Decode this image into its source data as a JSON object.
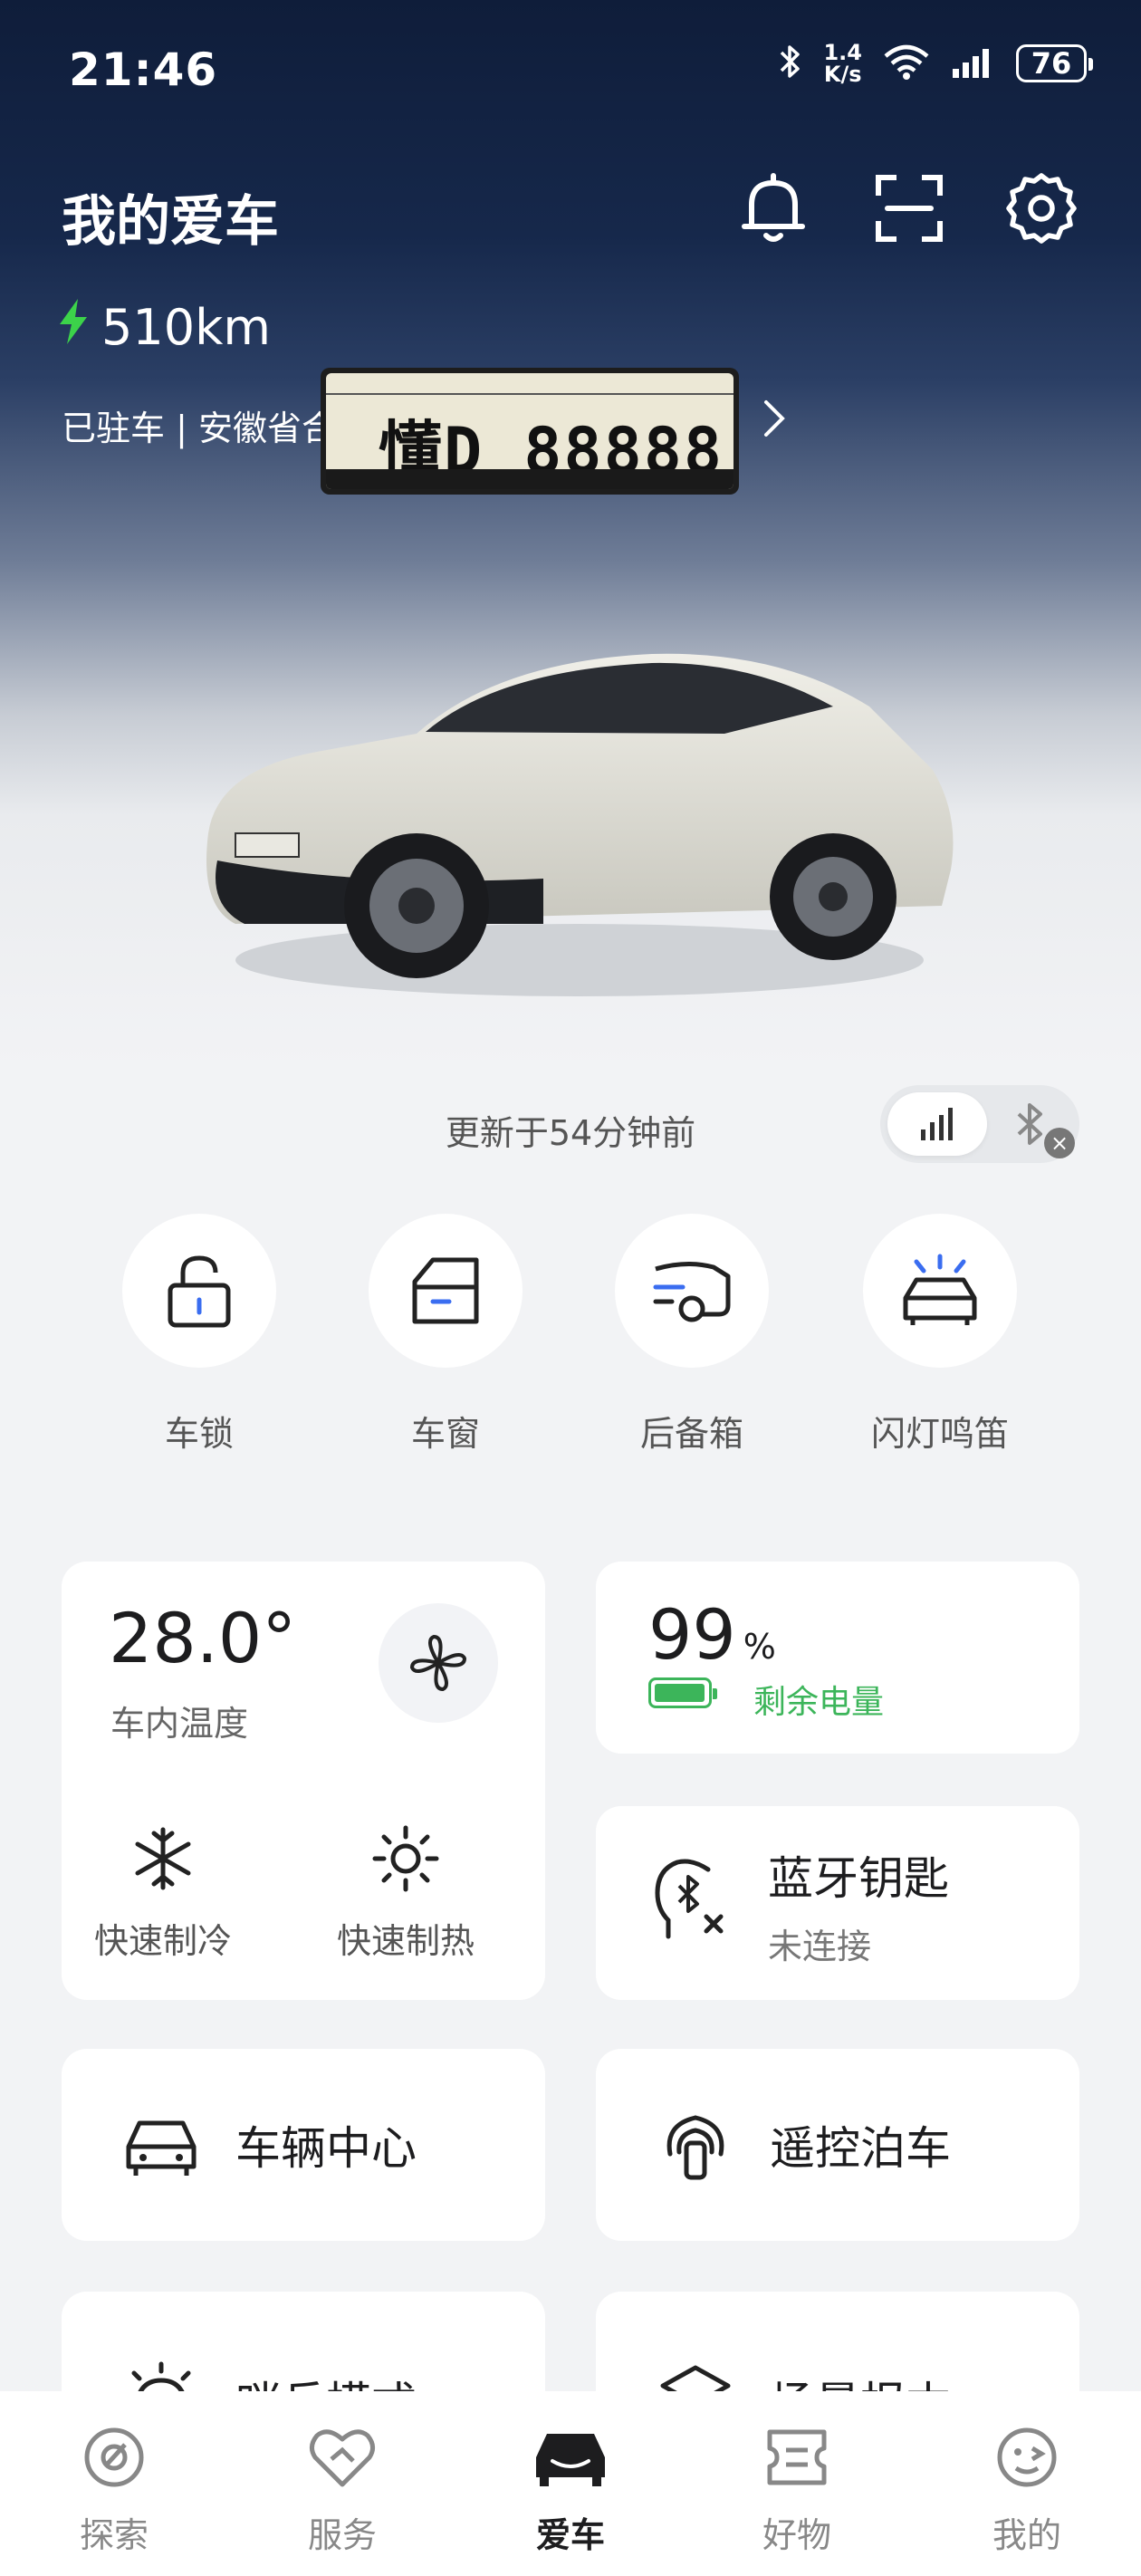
{
  "status_bar": {
    "time": "21:46",
    "net_speed_value": "1.4",
    "net_speed_unit": "K/s",
    "battery": "76"
  },
  "header": {
    "title": "我的爱车",
    "range": "510km",
    "parking": "已驻车 | 安徽省合"
  },
  "plate": {
    "number": "懂D 88888"
  },
  "sync": {
    "updated_text": "更新于54分钟前"
  },
  "quick_actions": [
    {
      "label": "车锁",
      "icon": "lock-icon"
    },
    {
      "label": "车窗",
      "icon": "window-icon"
    },
    {
      "label": "后备箱",
      "icon": "trunk-icon"
    },
    {
      "label": "闪灯鸣笛",
      "icon": "flash-horn-icon"
    }
  ],
  "climate": {
    "temperature": "28.0°",
    "label": "车内温度",
    "cool_label": "快速制冷",
    "heat_label": "快速制热"
  },
  "battery_card": {
    "value": "99",
    "unit": "%",
    "label": "剩余电量",
    "level": 0.99
  },
  "bt_key": {
    "title": "蓝牙钥匙",
    "status": "未连接"
  },
  "services": {
    "vehicle_center": "车辆中心",
    "remote_park": "遥控泊车",
    "sentry": "哨兵模式",
    "scene": "场景报本"
  },
  "tabs": [
    {
      "label": "探索",
      "icon": "explore-icon"
    },
    {
      "label": "服务",
      "icon": "service-icon"
    },
    {
      "label": "爱车",
      "icon": "car-icon",
      "active": true
    },
    {
      "label": "好物",
      "icon": "shop-icon"
    },
    {
      "label": "我的",
      "icon": "profile-icon"
    }
  ],
  "colors": {
    "accent_green": "#3cb55a",
    "accent_blue": "#3a6df0",
    "hero_dark": "#0f1d3a"
  }
}
